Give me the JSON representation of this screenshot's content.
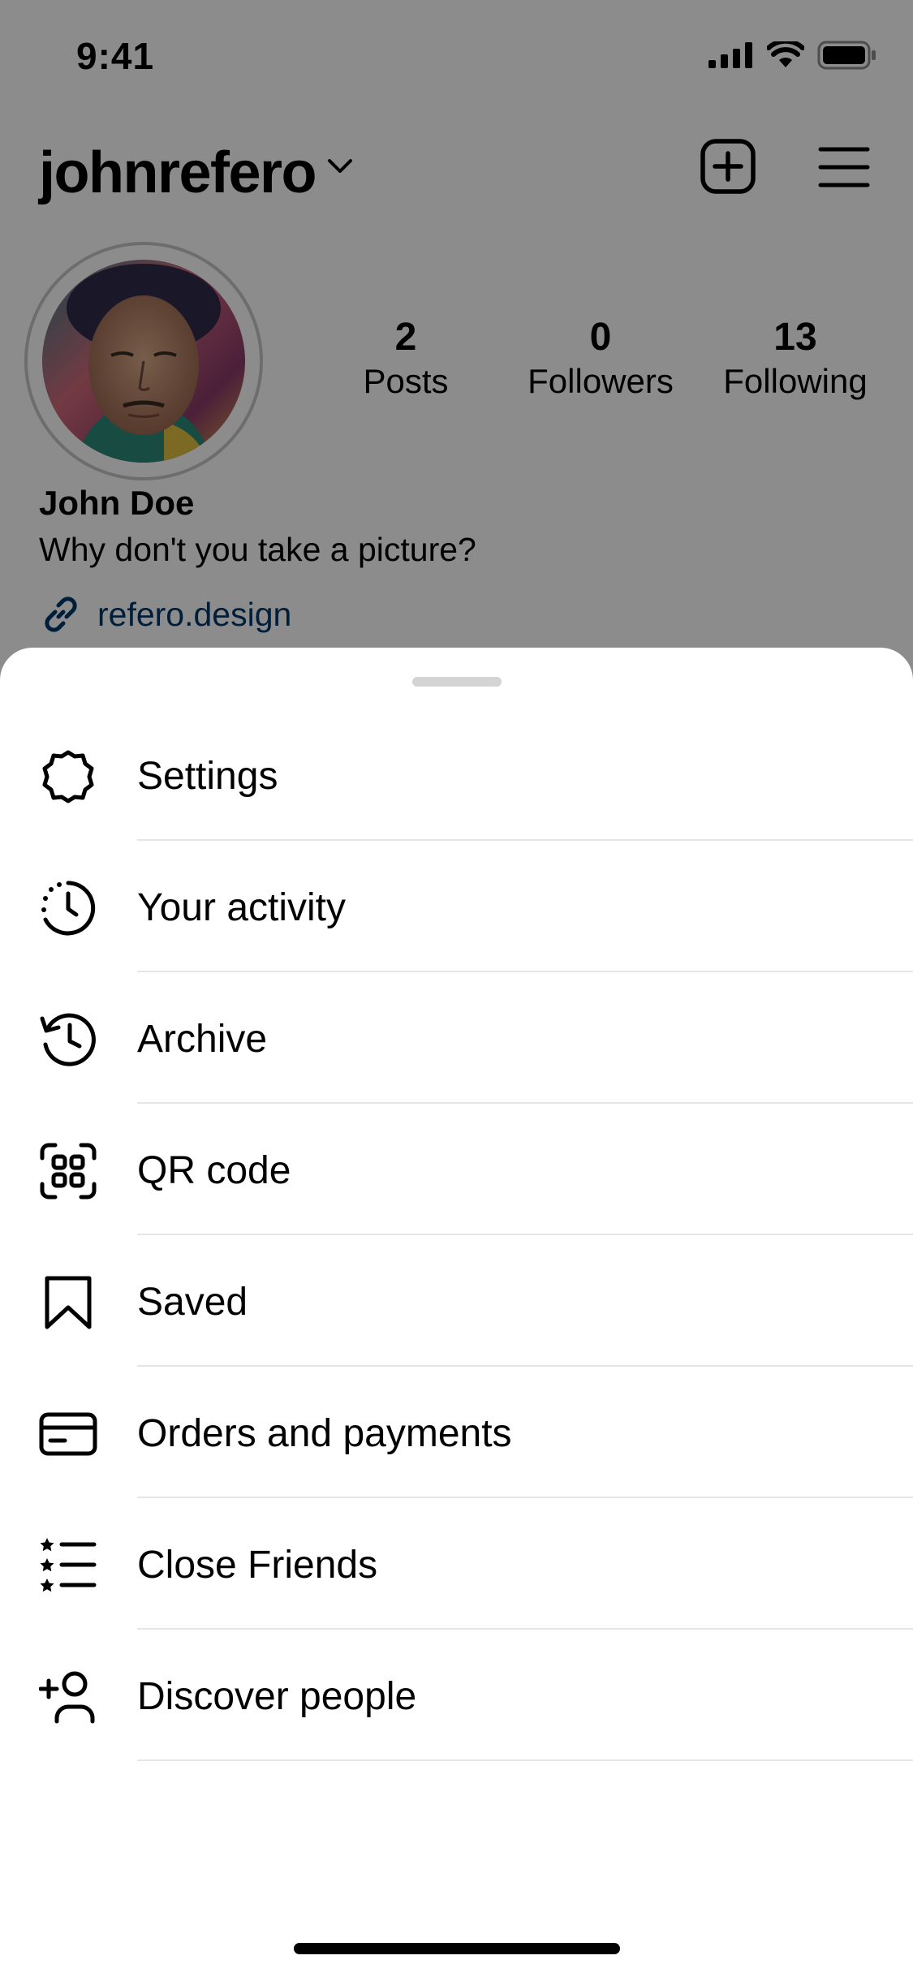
{
  "status_bar": {
    "time": "9:41"
  },
  "profile": {
    "username": "johnrefero",
    "stats": [
      {
        "value": "2",
        "label": "Posts"
      },
      {
        "value": "0",
        "label": "Followers"
      },
      {
        "value": "13",
        "label": "Following"
      }
    ],
    "display_name": "John Doe",
    "bio": "Why don't you take a picture?",
    "website": "refero.design"
  },
  "sheet": {
    "items": [
      {
        "label": "Settings",
        "icon": "settings-icon"
      },
      {
        "label": "Your activity",
        "icon": "activity-icon"
      },
      {
        "label": "Archive",
        "icon": "archive-icon"
      },
      {
        "label": "QR code",
        "icon": "qr-code-icon"
      },
      {
        "label": "Saved",
        "icon": "bookmark-icon"
      },
      {
        "label": "Orders and payments",
        "icon": "card-icon"
      },
      {
        "label": "Close Friends",
        "icon": "close-friends-list-icon"
      },
      {
        "label": "Discover people",
        "icon": "add-person-icon"
      }
    ]
  },
  "colors": {
    "link": "#00376b",
    "divider": "#e6e6e6",
    "overlay": "rgba(0,0,0,0.45)"
  }
}
